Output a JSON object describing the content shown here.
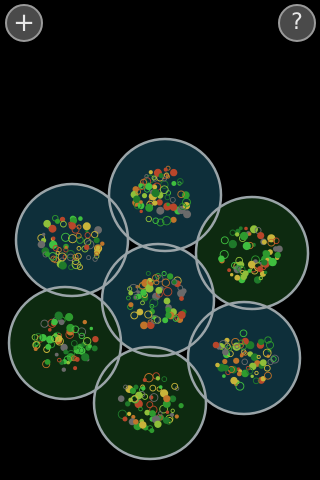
{
  "toolbar": {
    "add_label": "+",
    "help_label": "?"
  },
  "colors": {
    "ring": "#9aa4a8",
    "dish_teal": "#0e2f3a",
    "dish_green": "#0d2a10",
    "cell_palette": [
      "#2e9a2e",
      "#3fbf3f",
      "#1f7a2a",
      "#c8b43a",
      "#c0742a",
      "#b8462a",
      "#8fbf3a",
      "#6a6a6a"
    ]
  },
  "dishes": [
    {
      "name": "dish-top",
      "tint": "teal"
    },
    {
      "name": "dish-upper-left",
      "tint": "teal"
    },
    {
      "name": "dish-upper-right",
      "tint": "green"
    },
    {
      "name": "dish-center",
      "tint": "teal"
    },
    {
      "name": "dish-lower-left",
      "tint": "green"
    },
    {
      "name": "dish-lower-right",
      "tint": "teal"
    },
    {
      "name": "dish-bottom",
      "tint": "green"
    }
  ]
}
